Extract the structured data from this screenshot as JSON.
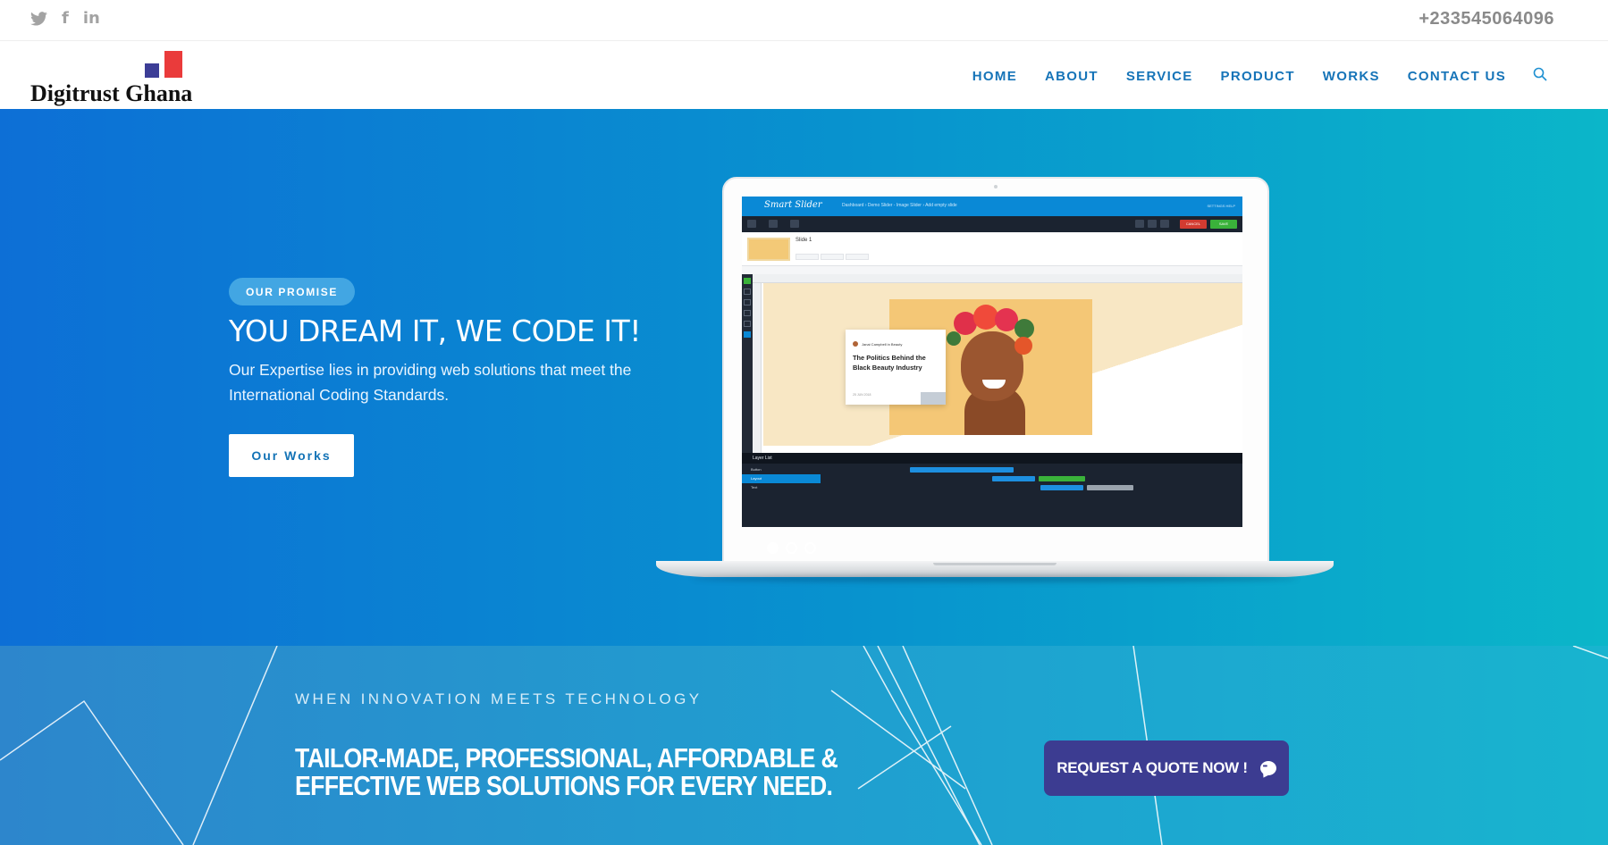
{
  "topbar": {
    "social": [
      {
        "name": "twitter-icon"
      },
      {
        "name": "facebook-icon",
        "glyph": "f"
      },
      {
        "name": "linkedin-icon",
        "glyph": "in"
      }
    ],
    "phone": "+233545064096"
  },
  "header": {
    "logo_text": "Digitrust Ghana",
    "nav": [
      {
        "label": "HOME"
      },
      {
        "label": "ABOUT"
      },
      {
        "label": "SERVICE"
      },
      {
        "label": "PRODUCT"
      },
      {
        "label": "WORKS"
      },
      {
        "label": "CONTACT US"
      }
    ]
  },
  "hero": {
    "badge": "OUR PROMISE",
    "title": "YOU DREAM IT, WE CODE IT!",
    "subtitle": "Our Expertise lies in providing web solutions that meet the International Coding Standards.",
    "button": "Our Works",
    "slides_total": 3,
    "active_slide": 1,
    "laptop_screen": {
      "brand": "Smart Slider",
      "breadcrumb": "Dashboard  ›  Demo Slider - Image Slider  ›  Add empty slide",
      "menu": "SETTINGS    HELP",
      "cancel": "CANCEL",
      "save": "SAVE",
      "slide_name": "Slide 1",
      "card_author": "Janai Campbell in Beauty",
      "card_title": "The Politics Behind the Black Beauty Industry",
      "card_date": "25 JUN 2018",
      "layer_list": "Layer List",
      "layers": [
        "Button",
        "Layout",
        "Text"
      ]
    }
  },
  "band": {
    "kicker": "WHEN INNOVATION MEETS TECHNOLOGY",
    "title": "TAILOR-MADE, PROFESSIONAL, AFFORDABLE & EFFECTIVE WEB SOLUTIONS FOR EVERY NEED.",
    "cta": "REQUEST A QUOTE NOW !"
  },
  "colors": {
    "accent_blue": "#1674b8",
    "hero_start": "#0d6fd6",
    "hero_end": "#0bb6c9",
    "cta_button": "#3c3c91",
    "logo_red": "#ea3b3b",
    "logo_blue": "#3c3d96"
  }
}
